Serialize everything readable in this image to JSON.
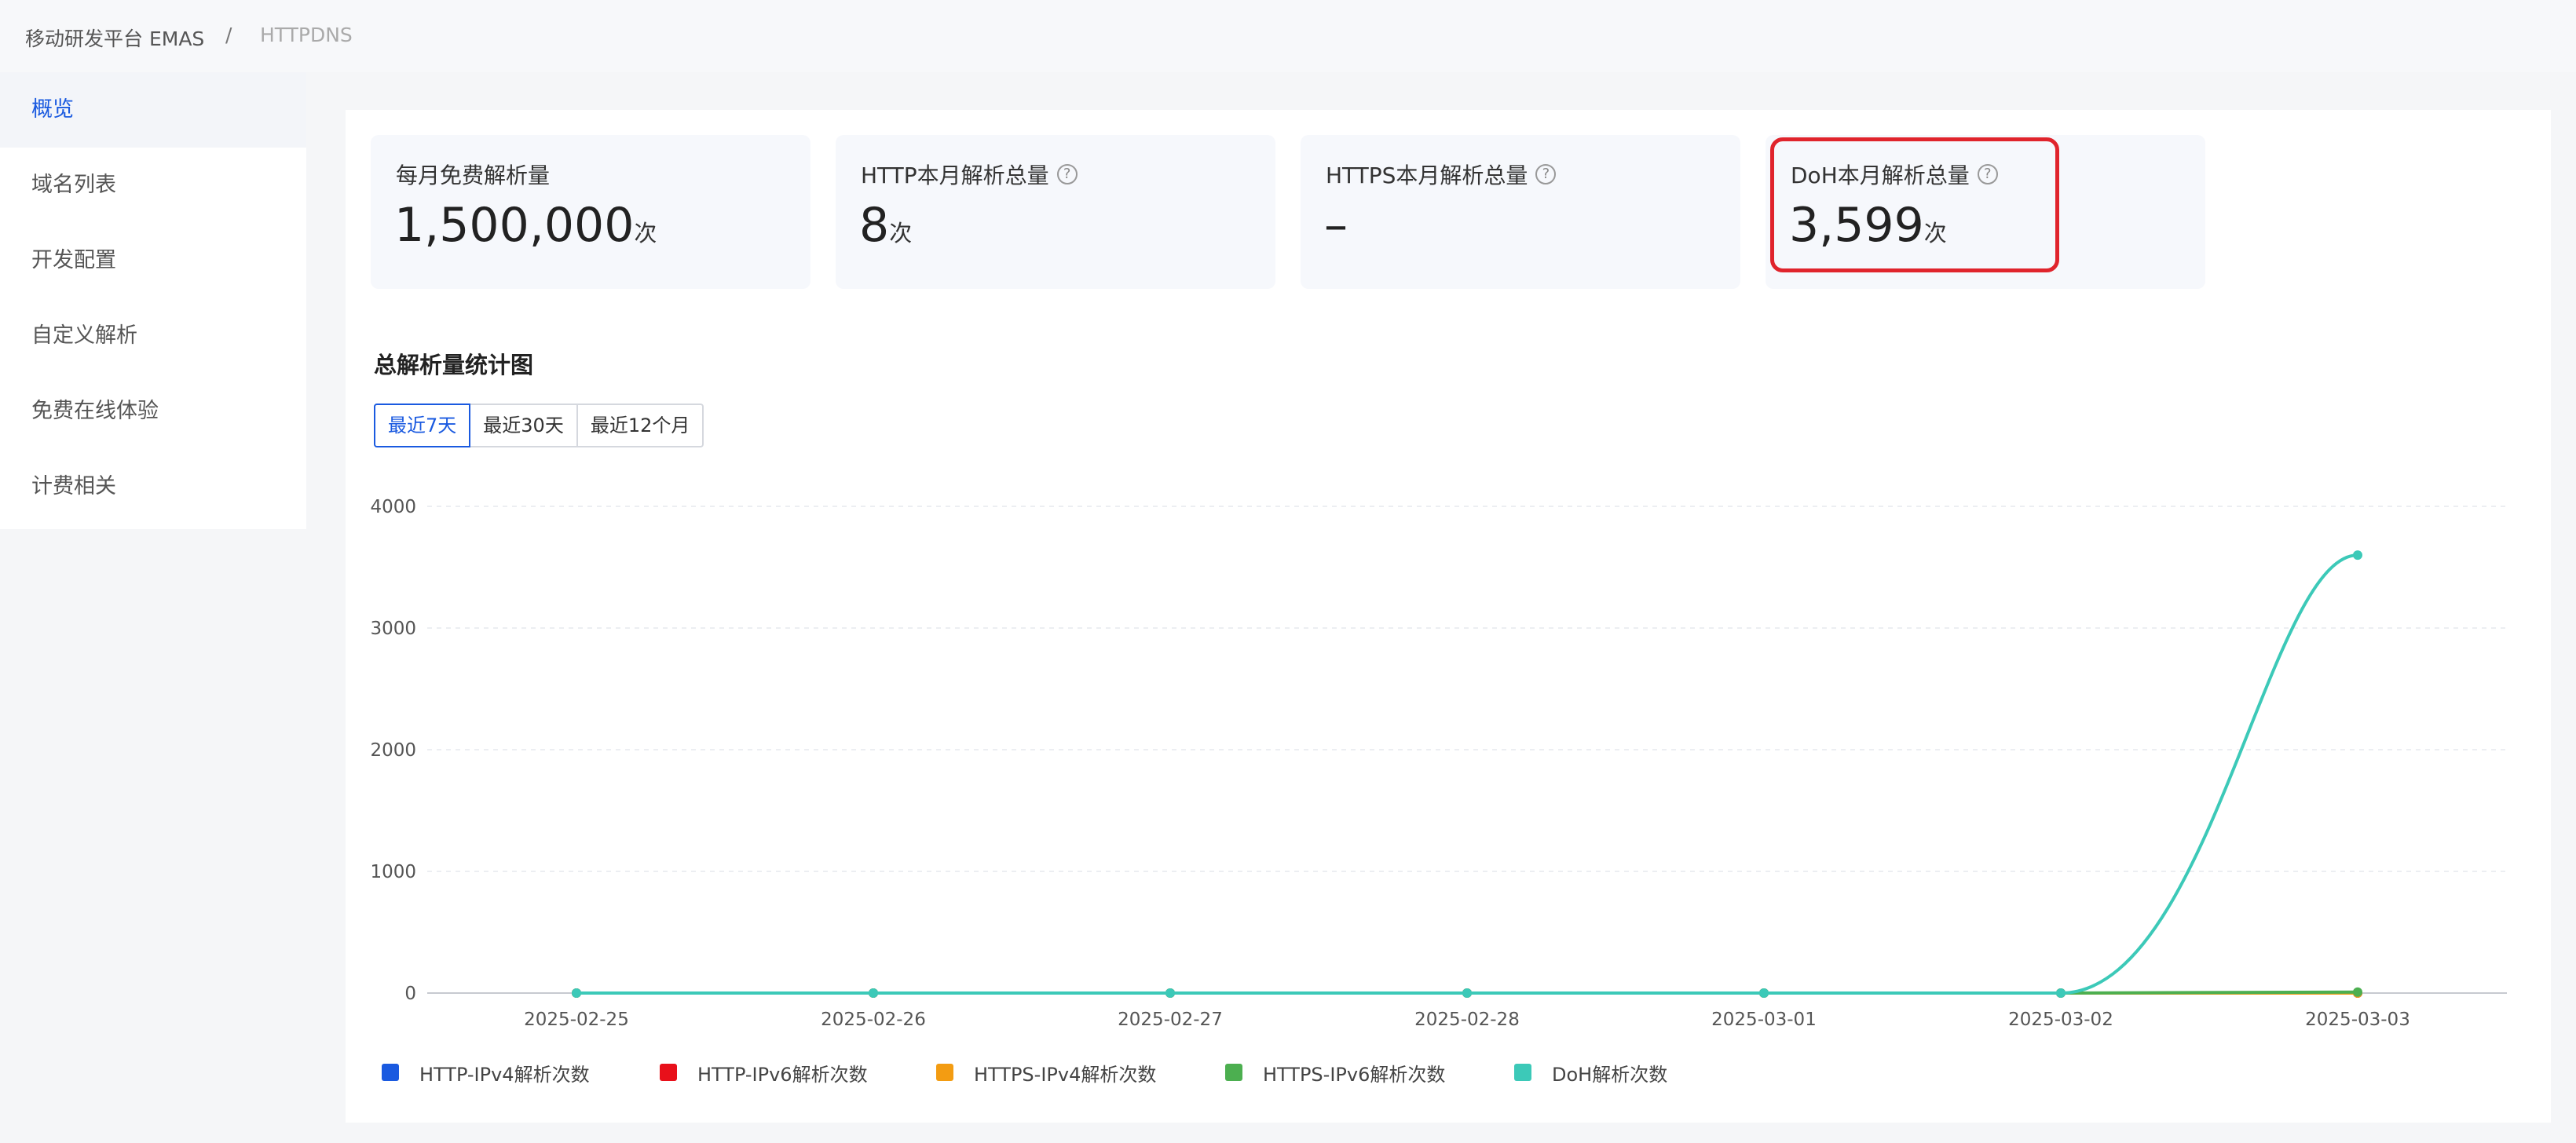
{
  "breadcrumb": {
    "root": "移动研发平台 EMAS",
    "separator": "/",
    "current": "HTTPDNS"
  },
  "sidebar": {
    "items": [
      {
        "label": "概览",
        "active": true
      },
      {
        "label": "域名列表"
      },
      {
        "label": "开发配置"
      },
      {
        "label": "自定义解析"
      },
      {
        "label": "免费在线体验"
      },
      {
        "label": "计费相关"
      }
    ]
  },
  "stats": [
    {
      "label": "每月免费解析量",
      "value": "1,500,000",
      "unit": "次",
      "help": false
    },
    {
      "label": "HTTP本月解析总量",
      "value": "8",
      "unit": "次",
      "help": true
    },
    {
      "label": "HTTPS本月解析总量",
      "value": "–",
      "unit": "",
      "help": true
    },
    {
      "label": "DoH本月解析总量",
      "value": "3,599",
      "unit": "次",
      "help": true,
      "highlighted": true
    }
  ],
  "help_icon_glyph": "?",
  "highlight_color": "#e0242c",
  "accent_color": "#1a5ae0",
  "chart_section": {
    "title": "总解析量统计图",
    "ranges": [
      {
        "label": "最近7天",
        "active": true
      },
      {
        "label": "最近30天"
      },
      {
        "label": "最近12个月"
      }
    ]
  },
  "chart_data": {
    "type": "line",
    "x": [
      "2025-02-25",
      "2025-02-26",
      "2025-02-27",
      "2025-02-28",
      "2025-03-01",
      "2025-03-02",
      "2025-03-03"
    ],
    "ylim": [
      0,
      4000
    ],
    "yticks": [
      0,
      1000,
      2000,
      3000,
      4000
    ],
    "grid": true,
    "legend_position": "bottom-left",
    "series": [
      {
        "name": "HTTP-IPv4解析次数",
        "color": "#1a5ae0",
        "values": [
          0,
          0,
          0,
          0,
          0,
          0,
          0
        ]
      },
      {
        "name": "HTTP-IPv6解析次数",
        "color": "#e8101a",
        "values": [
          0,
          0,
          0,
          0,
          0,
          0,
          0
        ]
      },
      {
        "name": "HTTPS-IPv4解析次数",
        "color": "#f39c12",
        "values": [
          0,
          0,
          0,
          0,
          0,
          0,
          0
        ]
      },
      {
        "name": "HTTPS-IPv6解析次数",
        "color": "#4caf50",
        "values": [
          0,
          0,
          0,
          0,
          0,
          0,
          8
        ]
      },
      {
        "name": "DoH解析次数",
        "color": "#3cc9b8",
        "values": [
          0,
          0,
          0,
          0,
          0,
          0,
          3599
        ]
      }
    ]
  }
}
